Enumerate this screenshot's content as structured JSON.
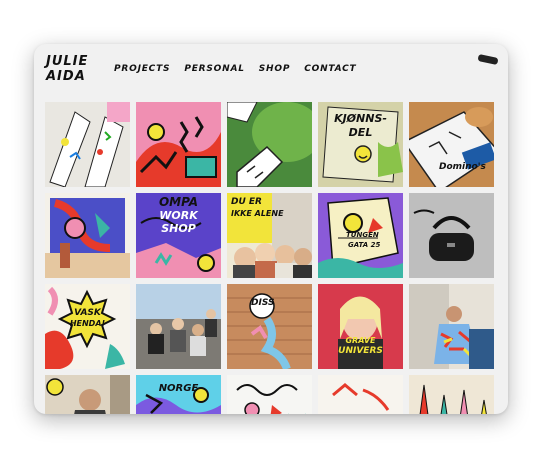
{
  "site": {
    "logo_line1": "JULIE",
    "logo_line2": "AIDA"
  },
  "nav": {
    "items": [
      {
        "label": "PROJECTS"
      },
      {
        "label": "PERSONAL"
      },
      {
        "label": "SHOP"
      },
      {
        "label": "CONTACT"
      }
    ]
  },
  "gallery": {
    "tiles": [
      {
        "label": ""
      },
      {
        "label": ""
      },
      {
        "label": ""
      },
      {
        "label": "KJØNNS-DEL"
      },
      {
        "label": "Domino's Pizza"
      },
      {
        "label": ""
      },
      {
        "label": "OMPA WORKSHOP"
      },
      {
        "label": "DU ER IKKE ALENE"
      },
      {
        "label": ""
      },
      {
        "label": ""
      },
      {
        "label": "VASK HENDA!"
      },
      {
        "label": ""
      },
      {
        "label": "DISS"
      },
      {
        "label": ""
      },
      {
        "label": ""
      },
      {
        "label": ""
      },
      {
        "label": ""
      },
      {
        "label": ""
      },
      {
        "label": ""
      },
      {
        "label": ""
      }
    ],
    "tile_overlays": {
      "t4_line1": "KJØNNS-",
      "t4_line2": "DEL",
      "t5_text": "Domino's",
      "t7_line1": "OMPA",
      "t7_line2": "WORK",
      "t7_line3": "SHOP",
      "t8_line1": "DU ER",
      "t8_line2": "IKKE ALENE",
      "t11_line1": "VASK",
      "t11_line2": "HENDA!",
      "t13_text": "DISS",
      "t14_line1": "GRAVE",
      "t14_line2": "UNIVERS",
      "t17_text": "NORGE",
      "t9_text": "TUNGEN",
      "t9_text2": "GATA 25"
    }
  },
  "colors": {
    "card_bg": "#f1f1f1",
    "accent_yellow": "#f2e43a",
    "accent_red": "#e63a2b",
    "accent_purple": "#6b4dd8"
  }
}
